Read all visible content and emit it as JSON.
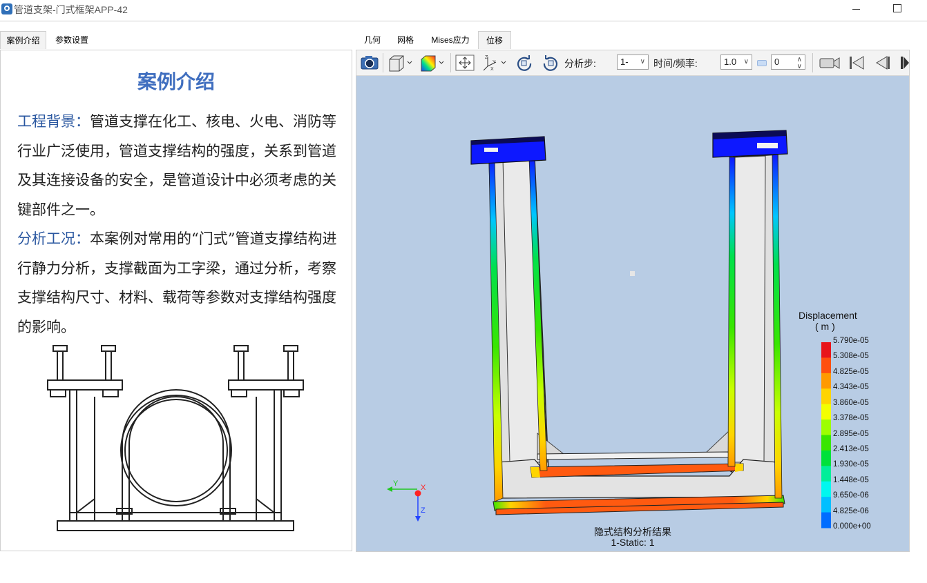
{
  "window": {
    "title": "管道支架-门式框架APP-42"
  },
  "left_tabs": [
    {
      "label": "案例介绍"
    },
    {
      "label": "参数设置"
    }
  ],
  "right_tabs": [
    {
      "label": "几何"
    },
    {
      "label": "网格"
    },
    {
      "label": "Mises应力"
    },
    {
      "label": "位移"
    }
  ],
  "intro": {
    "title": "案例介绍",
    "background_label": "工程背景：",
    "background_text": "管道支撑在化工、核电、火电、消防等行业广泛使用，管道支撑结构的强度，关系到管道及其连接设备的安全，是管道设计中必须考虑的关键部件之一。",
    "analysis_label": "分析工况：",
    "analysis_text": "本案例对常用的“门式”管道支撑结构进行静力分析，支撑截面为工字梁，通过分析，考察支撑结构尺寸、材料、载荷等参数对支撑结构强度的影响。"
  },
  "toolbar": {
    "step_label": "分析步:",
    "step_value": "1-",
    "time_label": "时间/频率:",
    "time_value": "1.0",
    "frame_value": "0"
  },
  "legend": {
    "title": "Displacement",
    "unit": "( m )",
    "labels": [
      "5.790e-05",
      "5.308e-05",
      "4.825e-05",
      "4.343e-05",
      "3.860e-05",
      "3.378e-05",
      "2.895e-05",
      "2.413e-05",
      "1.930e-05",
      "1.448e-05",
      "9.650e-06",
      "4.825e-06",
      "0.000e+00"
    ],
    "colors": [
      "#e8141b",
      "#ff4f0f",
      "#ff9a00",
      "#ffd400",
      "#f3ff00",
      "#9dff00",
      "#39e600",
      "#00e13a",
      "#00ee9a",
      "#00f7ef",
      "#00bfff",
      "#006dff",
      "#0f19ff"
    ]
  },
  "axes": {
    "y": "Y",
    "x": "X",
    "z": "Z"
  },
  "caption": {
    "line1": "隐式结构分析结果",
    "line2": "1-Static: 1"
  }
}
